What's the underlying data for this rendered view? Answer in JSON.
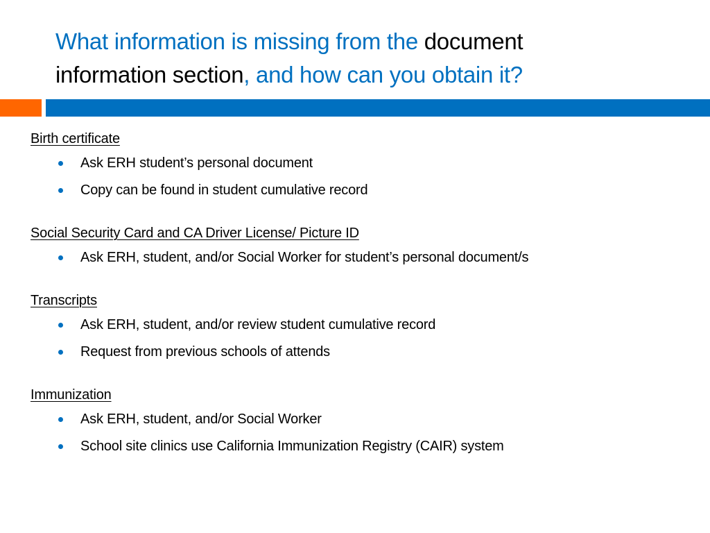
{
  "slide": {
    "title": {
      "part1": "What information is missing from the ",
      "part2": "document",
      "part3": "information section",
      "part4": ", and how can you obtain it?"
    },
    "colors": {
      "accent_blue": "#0070c0",
      "accent_orange": "#ff6600",
      "text": "#000000"
    },
    "sections": [
      {
        "heading": "Birth certificate",
        "items": [
          "Ask ERH student’s personal document",
          "Copy can be found in student cumulative record"
        ]
      },
      {
        "heading": "Social Security Card and CA Driver License/ Picture ID",
        "items": [
          "Ask ERH, student, and/or Social Worker for student’s personal document/s"
        ]
      },
      {
        "heading": "Transcripts",
        "items": [
          "Ask ERH, student, and/or review student cumulative record",
          "Request from previous schools of attends"
        ]
      },
      {
        "heading": "Immunization",
        "items": [
          "Ask ERH, student, and/or Social Worker",
          "School site clinics use California Immunization Registry (CAIR)  system"
        ]
      }
    ]
  }
}
